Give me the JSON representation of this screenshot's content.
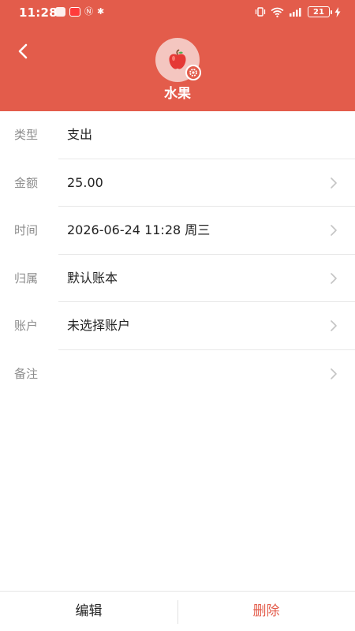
{
  "status_bar": {
    "time": "11:28",
    "battery": "21"
  },
  "header": {
    "category_name": "水果",
    "category_icon": "apple-icon",
    "background_color": "#e35c4b"
  },
  "details": [
    {
      "label": "类型",
      "value": "支出",
      "has_chevron": false
    },
    {
      "label": "金额",
      "value": "25.00",
      "has_chevron": true
    },
    {
      "label": "时间",
      "value": "2026-06-24 11:28 周三",
      "has_chevron": true
    },
    {
      "label": "归属",
      "value": "默认账本",
      "has_chevron": true
    },
    {
      "label": "账户",
      "value": "未选择账户",
      "has_chevron": true
    },
    {
      "label": "备注",
      "value": "",
      "has_chevron": true
    }
  ],
  "footer": {
    "edit_label": "编辑",
    "delete_label": "删除",
    "delete_color": "#e35c4b"
  }
}
